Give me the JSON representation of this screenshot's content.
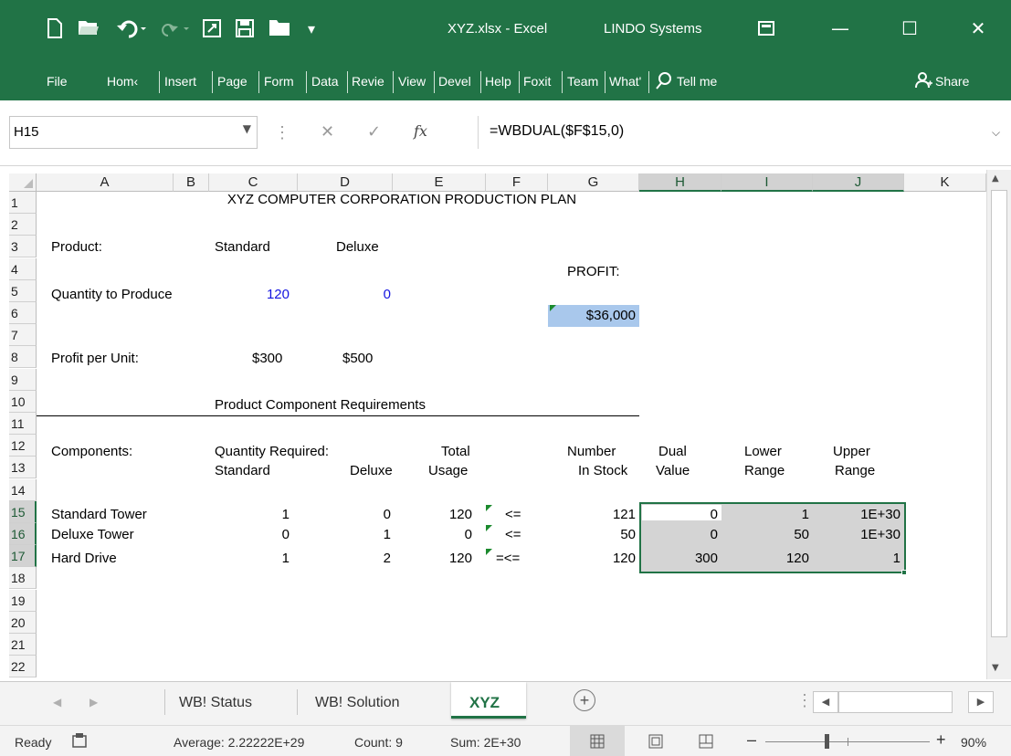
{
  "titlebar": {
    "title": "XYZ.xlsx  -  Excel",
    "addin": "LINDO Systems",
    "colors": {
      "accent": "#217346"
    }
  },
  "ribbon_tabs": [
    "File",
    "Hom‹",
    "Insert",
    "Page",
    "Form",
    "Data",
    "Revie",
    "View",
    "Devel",
    "Help",
    "Foxit",
    "Team",
    "What'"
  ],
  "ribbon_right": {
    "tellme": "Tell me",
    "share": "Share"
  },
  "formula_bar": {
    "name_box": "H15",
    "formula": "=WBDUAL($F$15,0)"
  },
  "columns": [
    "A",
    "B",
    "C",
    "D",
    "E",
    "F",
    "G",
    "H",
    "I",
    "J",
    "K"
  ],
  "rows": [
    "1",
    "2",
    "3",
    "4",
    "5",
    "6",
    "7",
    "8",
    "9",
    "10",
    "11",
    "12",
    "13",
    "14",
    "15",
    "16",
    "17",
    "18",
    "19",
    "20",
    "21",
    "22"
  ],
  "sheet": {
    "title": "XYZ COMPUTER CORPORATION PRODUCTION PLAN",
    "product_label": "Product:",
    "standard": "Standard",
    "deluxe": "Deluxe",
    "profit_label": "PROFIT:",
    "qty_label": "Quantity to Produce",
    "qty_standard": "120",
    "qty_deluxe": "0",
    "profit_value": "$36,000",
    "ppu_label": "Profit per Unit:",
    "ppu_standard": "$300",
    "ppu_deluxe": "$500",
    "section_title": "Product Component Requirements",
    "hdr_components": "Components:",
    "hdr_qty_required": "Quantity Required:",
    "hdr_total": "Total",
    "hdr_number": "Number",
    "hdr_dual": "Dual",
    "hdr_lower": "Lower",
    "hdr_upper": "Upper",
    "hdr_standard": "Standard",
    "hdr_deluxe": "Deluxe",
    "hdr_usage": "Usage",
    "hdr_instock": "In Stock",
    "hdr_value": "Value",
    "hdr_range1": "Range",
    "hdr_range2": "Range",
    "components": [
      {
        "name": "Standard Tower",
        "std": "1",
        "dlx": "0",
        "usage": "120",
        "op": "<=",
        "stock": "121",
        "dual": "0",
        "lower": "1",
        "upper": "1E+30"
      },
      {
        "name": "Deluxe Tower",
        "std": "0",
        "dlx": "1",
        "usage": "0",
        "op": "<=",
        "stock": "50",
        "dual": "0",
        "lower": "50",
        "upper": "1E+30"
      },
      {
        "name": "Hard Drive",
        "std": "1",
        "dlx": "2",
        "usage": "120",
        "op": "=<=",
        "stock": "120",
        "dual": "300",
        "lower": "120",
        "upper": "1"
      }
    ]
  },
  "sheet_tabs": [
    "WB! Status",
    "WB! Solution",
    "XYZ"
  ],
  "active_tab": "XYZ",
  "statusbar": {
    "ready": "Ready",
    "average": "Average: 2.22222E+29",
    "count": "Count: 9",
    "sum": "Sum: 2E+30",
    "zoom": "90%"
  }
}
